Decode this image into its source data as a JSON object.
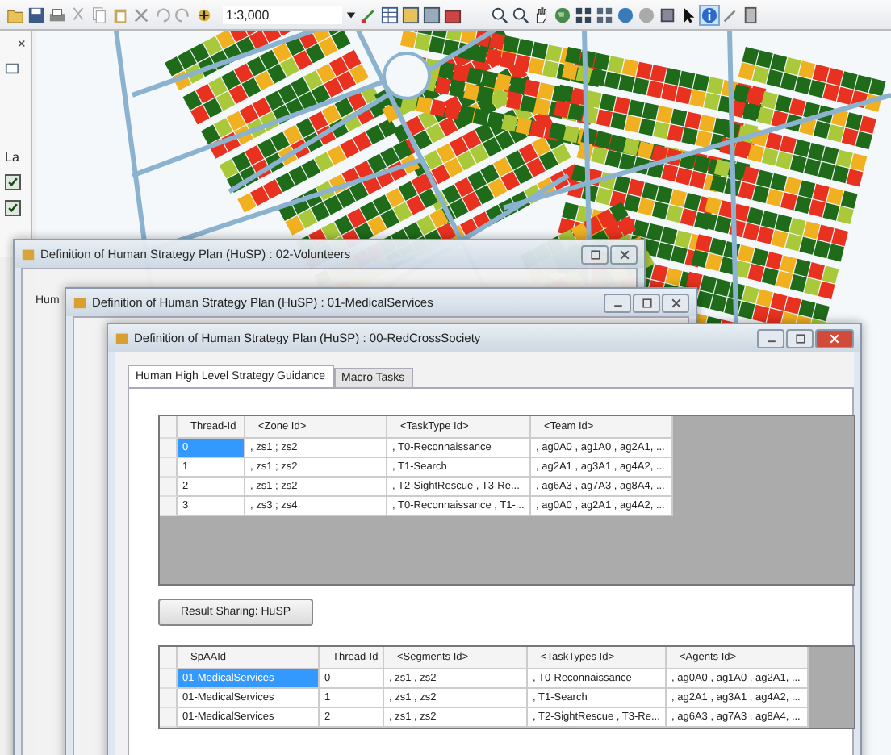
{
  "toolbar": {
    "scale": "1:3,000"
  },
  "left_panel": {
    "close": "×",
    "layer_label": "La",
    "layers": [
      {
        "checked": true
      },
      {
        "checked": true
      }
    ]
  },
  "back_windows": [
    {
      "title": "Definition of Human Strategy Plan (HuSP) : 02-Volunteers",
      "tab_stub": "Hum"
    },
    {
      "title": "Definition of Human Strategy Plan (HuSP) : 01-MedicalServices"
    }
  ],
  "window": {
    "title": "Definition of Human Strategy Plan (HuSP) : 00-RedCrossSociety",
    "tabs": [
      {
        "label": "Human High Level Strategy Guidance",
        "selected": true
      },
      {
        "label": "Macro Tasks",
        "selected": false
      }
    ],
    "threads_table": {
      "columns": [
        "Thread-Id",
        "<Zone Id>",
        "<TaskType Id>",
        "<Team Id>"
      ],
      "rows": [
        {
          "cells": [
            "0",
            ", zs1 ; zs2",
            ", T0-Reconnaissance",
            ", ag0A0 , ag1A0 , ag2A1, ..."
          ],
          "selected": true
        },
        {
          "cells": [
            "1",
            ", zs1 ; zs2",
            ", T1-Search",
            ", ag2A1 , ag3A1 , ag4A2, ..."
          ],
          "selected": false
        },
        {
          "cells": [
            "2",
            ", zs1 ; zs2",
            ", T2-SightRescue , T3-Re...",
            ", ag6A3 , ag7A3 , ag8A4, ..."
          ],
          "selected": false
        },
        {
          "cells": [
            "3",
            ", zs3 ; zs4",
            ", T0-Reconnaissance , T1-...",
            ", ag0A0 , ag2A1 , ag4A2, ..."
          ],
          "selected": false
        }
      ]
    },
    "button": "Result Sharing: HuSP",
    "result_table": {
      "columns": [
        "SpAAId",
        "Thread-Id",
        "<Segments Id>",
        "<TaskTypes Id>",
        "<Agents Id>"
      ],
      "rows": [
        {
          "cells": [
            "01-MedicalServices",
            "0",
            ", zs1 , zs2",
            ", T0-Reconnaissance",
            ", ag0A0 , ag1A0 , ag2A1, ..."
          ],
          "selected": true
        },
        {
          "cells": [
            "01-MedicalServices",
            "1",
            ", zs1 , zs2",
            ", T1-Search",
            ", ag2A1 , ag3A1 , ag4A2, ..."
          ],
          "selected": false
        },
        {
          "cells": [
            "01-MedicalServices",
            "2",
            ", zs1 , zs2",
            ", T2-SightRescue , T3-Re...",
            ", ag6A3 , ag7A3 , ag8A4, ..."
          ],
          "selected": false
        }
      ]
    }
  }
}
